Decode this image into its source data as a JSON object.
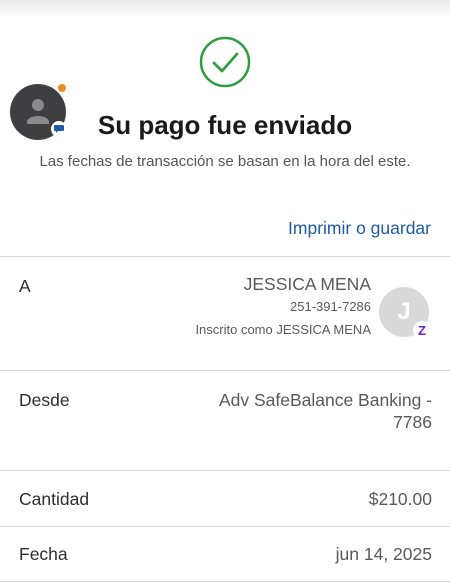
{
  "header": {
    "title": "Su pago fue enviado",
    "subtitle": "Las fechas de transacción se basan en la hora del este.",
    "print_link": "Imprimir o guardar"
  },
  "recipient": {
    "label": "A",
    "name": "JESSICA MENA",
    "phone": "251-391-7286",
    "enrolled_as": "Inscrito como JESSICA MENA",
    "avatar_initial": "J",
    "badge_glyph": "Z"
  },
  "from": {
    "label": "Desde",
    "value": "Adv SafeBalance Banking - 7786"
  },
  "amount": {
    "label": "Cantidad",
    "value": "$210.00"
  },
  "date": {
    "label": "Fecha",
    "value": "jun 14, 2025"
  },
  "colors": {
    "success_green": "#2e9d3e",
    "link_blue": "#1e5aa6",
    "zelle_purple": "#6d1ed4",
    "notification_orange": "#f08a2c"
  },
  "icons": {
    "success": "check-circle-icon",
    "profile": "person-icon",
    "chat": "chat-bubble-icon",
    "zelle": "zelle-icon"
  }
}
